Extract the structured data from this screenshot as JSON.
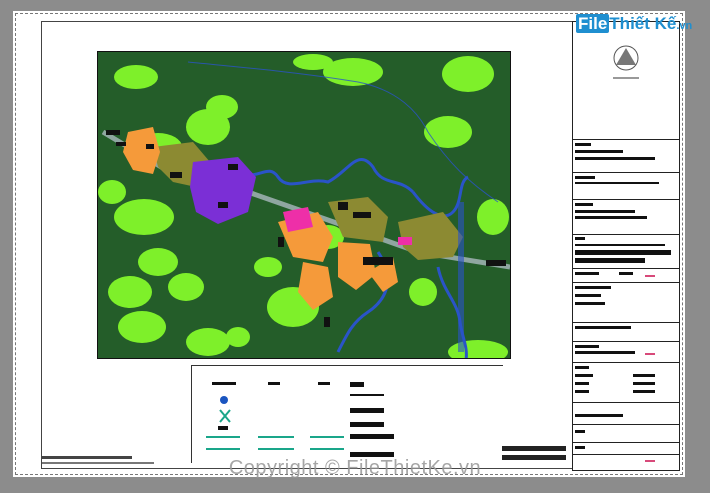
{
  "watermark": {
    "text": "Copyright © FileThietKe.vn"
  },
  "logo": {
    "box_text": "File",
    "rest_text": "Thiết Kế",
    "domain": ".vn"
  },
  "colors": {
    "forest": "#245d29",
    "green_patch": "#7ef02a",
    "orange_zone": "#f59a3a",
    "olive_zone": "#8c8a32",
    "purple_zone": "#7b2fd6",
    "pink_zone": "#ee2fa8",
    "river": "#2a54c8",
    "road": "#8fa6a0"
  }
}
